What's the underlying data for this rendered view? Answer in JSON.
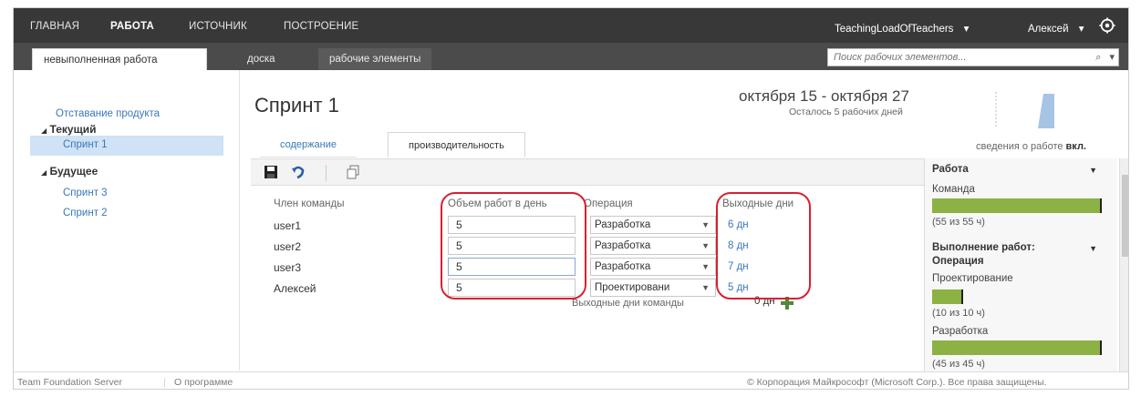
{
  "topnav": {
    "items": [
      "ГЛАВНАЯ",
      "РАБОТА",
      "ИСТОЧНИК",
      "ПОСТРОЕНИЕ"
    ],
    "active_index": 1,
    "project": "TeachingLoadOfTeachers",
    "user": "Алексей",
    "dropdown_icon": "chevron-down-icon",
    "settings_icon": "gear-icon"
  },
  "subtabs": {
    "items": [
      "невыполненная работа",
      "доска",
      "рабочие элементы"
    ],
    "active_index": 0
  },
  "search": {
    "placeholder": "Поиск рабочих элементов..."
  },
  "sidebar": {
    "product_backlog": "Отставание продукта",
    "current_label": "Текущий",
    "current_sprint": "Спринт 1",
    "future_label": "Будущее",
    "future_sprints": [
      "Спринт 3",
      "Спринт 2"
    ]
  },
  "sprint": {
    "title": "Спринт 1",
    "dates": "октября 15 - октября 27",
    "days_left": "Осталось 5 рабочих дней"
  },
  "page_tabs": {
    "contents": "содержание",
    "capacity": "производительность"
  },
  "work_details": {
    "label": "сведения о работе",
    "state": "вкл."
  },
  "capacity": {
    "headers": {
      "member": "Член команды",
      "per_day": "Объем работ в день",
      "activity": "Операция",
      "days_off": "Выходные дни"
    },
    "rows": [
      {
        "member": "user1",
        "per_day": "5",
        "activity": "Разработка",
        "days_off": "6 дн"
      },
      {
        "member": "user2",
        "per_day": "5",
        "activity": "Разработка",
        "days_off": "8 дн"
      },
      {
        "member": "user3",
        "per_day": "5",
        "activity": "Разработка",
        "days_off": "7 дн"
      },
      {
        "member": "Алексей",
        "per_day": "5",
        "activity": "Проектировани",
        "days_off": "5 дн"
      }
    ],
    "team_days_off_label": "Выходные дни команды",
    "team_days_off_value": "0 дн"
  },
  "right_panel": {
    "work_title": "Работа",
    "team_label": "Команда",
    "team_summary": "(55 из 55 ч)",
    "team_fill": 1.0,
    "activity_title_1": "Выполнение работ:",
    "activity_title_2": "Операция",
    "design_label": "Проектирование",
    "design_summary": "(10 из 10 ч)",
    "design_fill": 1.0,
    "dev_label": "Разработка",
    "dev_summary": "(45 из 45 ч)",
    "dev_fill": 1.0,
    "bar_color": "#8cb145"
  },
  "footer": {
    "product": "Team Foundation Server",
    "about": "О программе",
    "copyright": "© Корпорация Майкрософт (Microsoft Corp.). Все права защищены."
  },
  "colors": {
    "accent_link": "#3a77b8",
    "highlight_oval": "#d8202e",
    "nav_bg": "#383838"
  }
}
